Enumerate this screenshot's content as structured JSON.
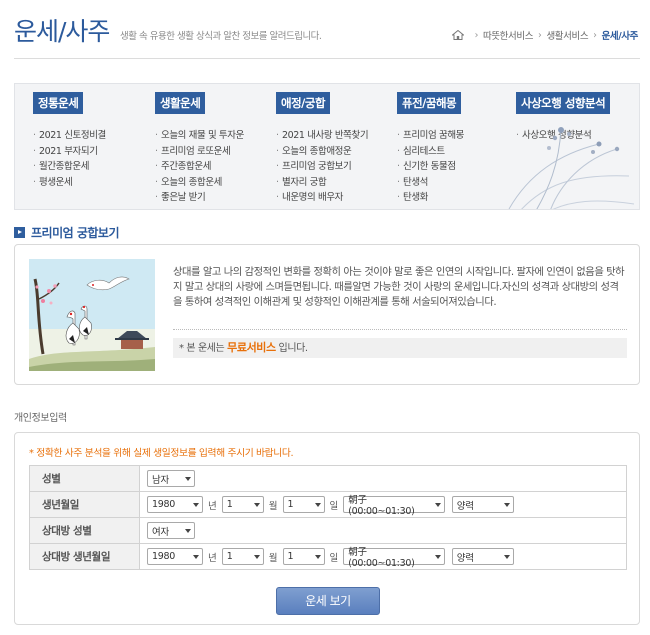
{
  "header": {
    "title": "운세/사주",
    "description": "생활 속 유용한 생활 상식과 알찬 정보를 알려드립니다.",
    "breadcrumb": [
      "따뜻한서비스",
      "생활서비스",
      "운세/사주"
    ]
  },
  "categories": [
    {
      "title": "정통운세",
      "items": [
        "2021 신토정비결",
        "2021 부자되기",
        "월간종합운세",
        "평생운세"
      ]
    },
    {
      "title": "생활운세",
      "items": [
        "오늘의 재물 및 투자운",
        "프리미엄 로또운세",
        "주간종합운세",
        "오늘의 종합운세",
        "좋은날 받기"
      ]
    },
    {
      "title": "애정/궁합",
      "items": [
        "2021 내사랑 반쪽찾기",
        "오늘의 종합애정운",
        "프리미엄 궁합보기",
        "별자리 궁합",
        "내운명의 배우자"
      ]
    },
    {
      "title": "퓨전/꿈해몽",
      "items": [
        "프리미엄 꿈해몽",
        "심리테스트",
        "신기한 동물점",
        "탄생석",
        "탄생화"
      ]
    },
    {
      "title": "사상오행 성향분석",
      "items": [
        "사상오행 성향분석"
      ]
    }
  ],
  "section": {
    "title": "프리미엄 궁합보기",
    "intro": "상대를 알고 나의 감정적인 변화를 정확히 아는 것이야 말로 좋은 인연의 시작입니다. 팔자에 인연이 없음을 탓하지 말고 상대의 사랑에 스며들면됩니다. 때를알면 가능한 것이 사랑의 운세입니다.자신의 성격과 상대방의 성격을 통하여 성격적인 이해관계 및 성향적인 이해관계를 통해 서술되어져있습니다.",
    "note_prefix": "* 본 운세는",
    "note_highlight": "무료서비스",
    "note_suffix": "입니다."
  },
  "form": {
    "heading": "개인정보입력",
    "notice": "* 정확한 사주 분석을 위해 실제 생일정보를 입력해 주시기 바랍니다.",
    "labels": {
      "gender": "성별",
      "birth": "생년월일",
      "partner_gender": "상대방 성별",
      "partner_birth": "상대방 생년월일"
    },
    "units": {
      "year": "년",
      "month": "월",
      "day": "일"
    },
    "my": {
      "gender": "남자",
      "year": "1980",
      "month": "1",
      "day": "1",
      "hour": "朝子(00:00~01:30)",
      "calendar": "양력"
    },
    "partner": {
      "gender": "여자",
      "year": "1980",
      "month": "1",
      "day": "1",
      "hour": "朝子(00:00~01:30)",
      "calendar": "양력"
    },
    "submit": "운세 보기"
  }
}
